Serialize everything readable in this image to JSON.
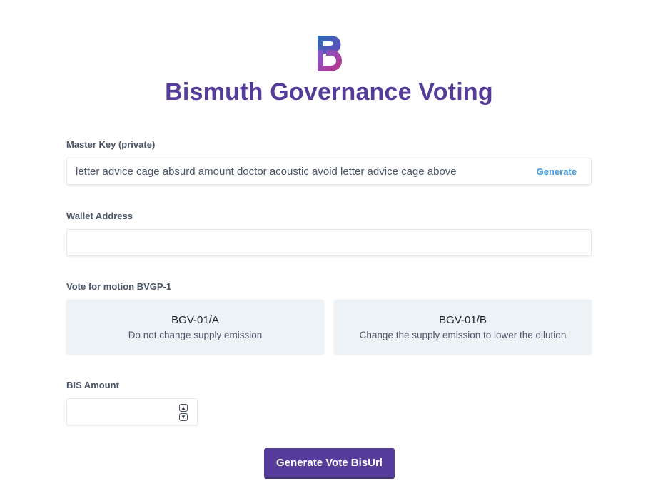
{
  "app": {
    "title": "Bismuth Governance Voting"
  },
  "master_key": {
    "label": "Master Key (private)",
    "value": "letter advice cage absurd amount doctor acoustic avoid letter advice cage above",
    "generate_label": "Generate"
  },
  "wallet": {
    "label": "Wallet Address",
    "value": ""
  },
  "vote": {
    "label": "Vote for motion BVGP-1",
    "options": [
      {
        "code": "BGV-01/A",
        "description": "Do not change supply emission"
      },
      {
        "code": "BGV-01/B",
        "description": "Change the supply emission to lower the dilution"
      }
    ]
  },
  "amount": {
    "label": "BIS Amount",
    "value": ""
  },
  "submit": {
    "label": "Generate Vote BisUrl"
  },
  "colors": {
    "brand": "#553c9a",
    "link": "#4299e1",
    "card_bg": "#edf2f7"
  }
}
